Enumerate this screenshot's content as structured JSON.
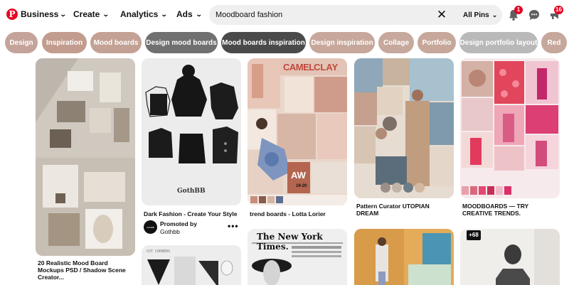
{
  "header": {
    "logo": "P",
    "business_label": "Business",
    "nav": [
      {
        "label": "Create"
      },
      {
        "label": "Analytics"
      },
      {
        "label": "Ads"
      }
    ],
    "search": {
      "value": "Moodboard fashion",
      "scope_label": "All Pins"
    },
    "notifications_count": "1",
    "updates_count": "16",
    "icons": {
      "logo": "pinterest-logo-icon",
      "clear": "close-icon",
      "bell": "bell-icon",
      "messages": "chat-bubble-icon",
      "updates": "megaphone-icon"
    }
  },
  "chips": [
    {
      "label": "Design",
      "color": "#c4a49a"
    },
    {
      "label": "Inspiration",
      "color": "#c29c8e"
    },
    {
      "label": "Mood boards",
      "color": "#c3a194"
    },
    {
      "label": "Design mood boards",
      "color": "#707070"
    },
    {
      "label": "Mood boards inspiration",
      "color": "#4a4a4a"
    },
    {
      "label": "Design inspiration",
      "color": "#c7a79b"
    },
    {
      "label": "Collage",
      "color": "#c6a89d"
    },
    {
      "label": "Portfolio",
      "color": "#c6a79a"
    },
    {
      "label": "Design portfolio layout",
      "color": "#b9b9b9"
    },
    {
      "label": "Red",
      "color": "#c6a79b"
    }
  ],
  "pins": {
    "p1": {
      "title": "20 Realistic Mood Board Mockups PSD / Shadow Scene Creator..."
    },
    "p2": {
      "title": "Dark Fashion - Create Your Style",
      "promoted_label": "Promoted by",
      "promoter": "Gothbb",
      "image_text": "GothBB",
      "avatar_text": "GothBB"
    },
    "p3": {
      "title": "trend boards - Lotta Lorier",
      "image_text_1": "CAMEL",
      "image_text_2": "CLAY",
      "image_text_3": "AW",
      "image_text_4": "19·20"
    },
    "p4": {
      "title": "Pattern Curator UTOPIAN DREAM"
    },
    "p5": {
      "title": "MOODBOARDS — TRY CREATIVE TRENDS."
    },
    "p6": {
      "image_text": "CUT CORNERS"
    },
    "p7": {
      "image_text": "The New York Times."
    },
    "p9": {
      "badge": "+68"
    }
  }
}
